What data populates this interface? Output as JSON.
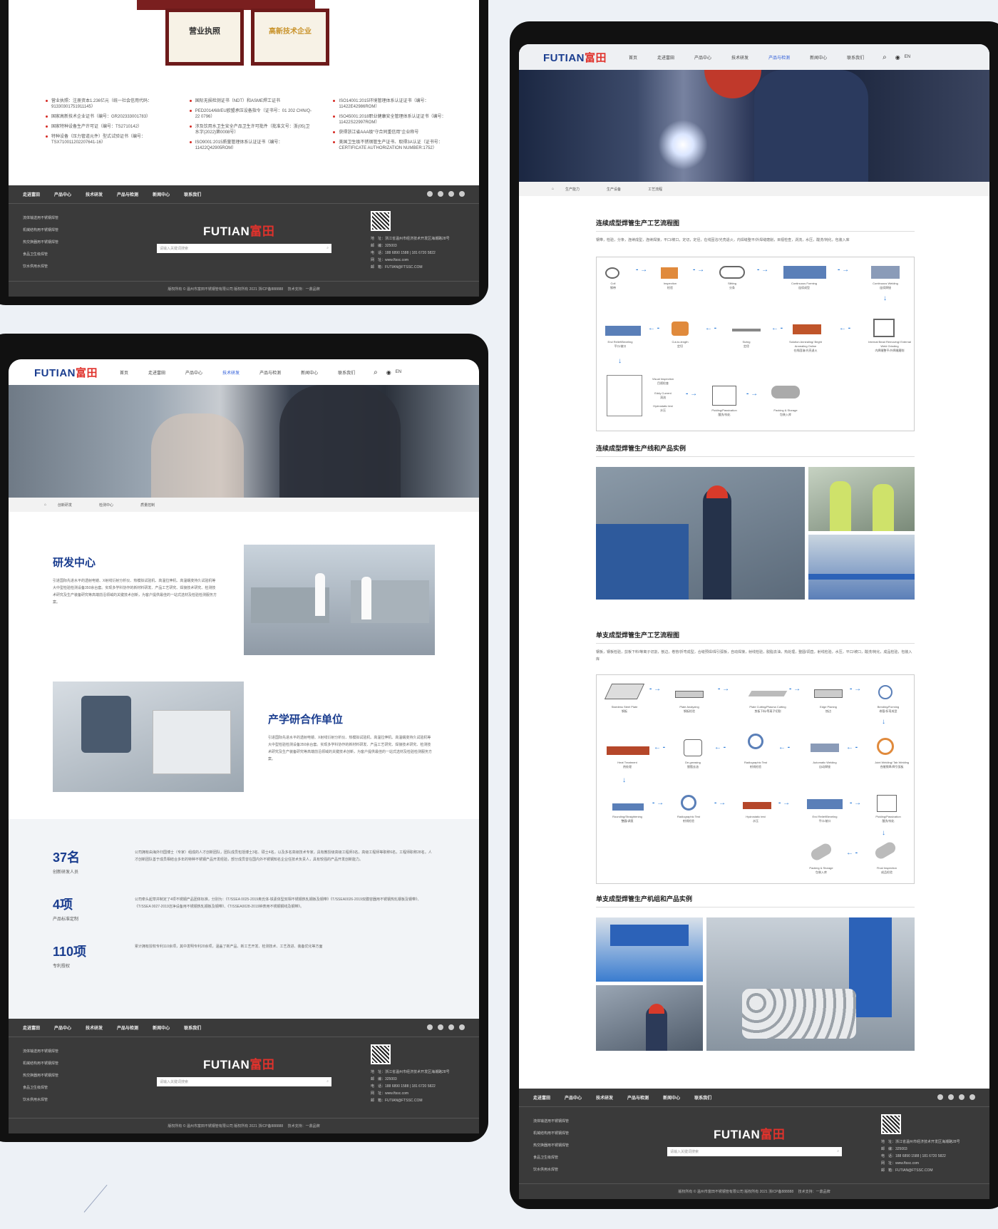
{
  "colors": {
    "brand_blue": "#1a3d8f",
    "brand_red": "#e0322c",
    "accent_blue": "#2c5bd8",
    "footer_bg": "#3a3a3a",
    "page_bg": "#edf1f6"
  },
  "logo": {
    "en": "FUTIAN",
    "cn": "富田"
  },
  "nav": [
    "首页",
    "走进富田",
    "产品中心",
    "技术研发",
    "产品与检测",
    "新闻中心",
    "联系我们"
  ],
  "lang": "EN",
  "footer": {
    "nav": [
      "走进富田",
      "产品中心",
      "技术研发",
      "产品与检测",
      "新闻中心",
      "联系我们"
    ],
    "links": [
      "流体输送用不锈钢焊管",
      "机械结构用不锈钢焊管",
      "热交换器用不锈钢焊管",
      "食品卫生级焊管",
      "饮水供用水焊管"
    ],
    "search_placeholder": "请输入关键词搜索",
    "contact": [
      "地　址：浙江省温州市经济技术开发区海潮路28号",
      "邮　编：325003",
      "电　话：188 6890 1588 | 181 6720 5822",
      "网　址：www.ftssc.com",
      "邮　箱：FUTIAN@FTSSC.COM"
    ],
    "copyright": "版权所有 © 温州市富田不锈钢管有限公司 版权所有 2021 浙ICP备888888 　技术支持：一鼎品牌"
  },
  "left_top": {
    "certificates": [
      "营业执照",
      "高新技术企业"
    ],
    "cert_cols": [
      [
        "营业执照：注册资本1.236亿元（统一社会信用代码：91330301751911145）",
        "国家高新技术企业证书（编号：GR202333001783）",
        "国家特种设备生产许可证（编号：TS2710142）",
        "特种设备（压力管道元件）型式试验证书（编号：TSX710011202207641-16）"
      ],
      [
        "国际无损检测证书（NDT）和ASME焊工证书",
        "PED2014/68/EU欧盟承压设备指令（证书号：01 202 CHN/Q-22 0796）",
        "涉及饮用水卫生安全产品卫生许可批件（批准文号：浙(05)卫水字(2022)第0008号）",
        "ISO9001:2015质量管理体系认证证书（编号：11422Q42905ROM）"
      ],
      [
        "ISO14001:2015环境管理体系认证证书（编号：11422E42986ROM）",
        "ISO45001:2018职业健康安全管理体系认证证书（编号：11422S22997ROM）",
        "获得浙江省AAA级“守合同重信用”企业称号",
        "美国卫生级不锈钢管生产证书、取得3A认证（证书号：CERTIFICATE AUTHORIZATION NUMBER:1752）"
      ]
    ]
  },
  "left_bottom": {
    "breadcrumb": [
      "创新研发",
      "检测中心",
      "质量控制"
    ],
    "rd_title": "研发中心",
    "rd_desc": "引进国际先进水平的透射电镜、X射线衍射分析仪、热模拟试验机、高温拉伸机、高温蠕变持久试验机等大中型检验检测设备350余台套。实现多学科协作的新材料研发、产品工艺研究、焊接技术研究、检测技术研究及生产装备研究等高端前沿领域的关键技术创新，为客户提供最佳的一站式选材及检验检测服务方案。",
    "coop_title": "产学研合作单位",
    "coop_desc": "引进国际先进水平的透射电镜、X射线衍射分析仪、热模拟试验机、高温拉伸机、高温蠕变持久试验机等大中型检验检测设备350余台套。实现多学科协作的新材料研发、产品工艺研究、焊接技术研究、检测技术研究及生产装备研究等高端前沿领域的关键技术创新，为客户提供最佳的一站式选材及检验检测服务方案。",
    "stats": [
      {
        "num": "37名",
        "label": "创新研发人员",
        "desc": "公司拥有由海外归国博士（专家）组成的人才创新团队，团队成员包括博士3名、硕士4名，以及多名高级技术专家，具有教授级高级工程师3名，高级工程师等职称6名，工程师职称28名。人才创新团队善于成员相结合多年的特种不锈钢产品开发经验，部分成员曾在国内外不锈钢知名企业任技术负责人，具有较强的产品开发创新能力。"
      },
      {
        "num": "4项",
        "label": "产品标准定制",
        "desc": "公司牵头起草并制定了4项不锈钢产品团体标准，分别为：《T/SSEA 0025-2019奥氏体-铁素体型双相不锈钢热轧钢板及钢带》《T/SSEA0026-2019双膜容器用不锈钢热轧钢板及钢带》、《T/SSEA 0027-2019洁净设备用不锈钢热轧钢板及钢带》、《T/SSEA0028-2019钟表用不锈钢钢线及钢带》。"
      },
      {
        "num": "110项",
        "label": "专利授权",
        "desc": "累计拥有授权专利110余项，其中发明专利20余项，涵盖了新产品、新工艺开发、检测技术、工艺改进、装备优化等方面"
      }
    ]
  },
  "right": {
    "breadcrumb": [
      "生产能力",
      "生产设备",
      "工艺流程"
    ],
    "s1_title": "连续成型焊管生产工艺流程图",
    "s1_desc": "钢带，检验，分条，连续成型，连续焊接，平口/坡口，定切，定径，在线固溶/光亮退火，内焊缝整平/外焊缝磨削，目视检查，涡流，水压，酸洗/钝化，包装入库",
    "flow1": [
      {
        "en": "Coil",
        "cn": "钢带"
      },
      {
        "en": "Inspection",
        "cn": "检验"
      },
      {
        "en": "Slitting",
        "cn": "分条"
      },
      {
        "en": "Continuous Forming",
        "cn": "连续成型"
      },
      {
        "en": "Continuous Welding",
        "cn": "连续焊接"
      },
      {
        "en": "End Relief/Beveling",
        "cn": "平口/坡口"
      },
      {
        "en": "Cut-to-length",
        "cn": "定切"
      },
      {
        "en": "Sizing",
        "cn": "定径"
      },
      {
        "en": "Solution Annealing/ Bright Annealing Online",
        "cn": "在线固溶/光亮退火"
      },
      {
        "en": "Internal Bead Removing/ External Weld Grinding",
        "cn": "内焊缝整平/外焊缝磨削"
      },
      {
        "en": "Visual Inspection",
        "cn": "目视检查"
      },
      {
        "en": "Eddy Current",
        "cn": "涡流"
      },
      {
        "en": "Hydrostatic test",
        "cn": "水压"
      },
      {
        "en": "Pickling/Passivation",
        "cn": "酸洗/钝化"
      },
      {
        "en": "Packing & Storage",
        "cn": "包装入库"
      }
    ],
    "s2_title": "连续成型焊管生产线和产品实例",
    "s3_title": "单支成型焊管生产工艺流程图",
    "s3_desc": "钢板，钢板检验，剪板下料/等离子切割，刨边，卷管/折弯成型，合缝预焊/焊引弧板，自动焊接，射线检验，脱脂去油，热处理，整圆/调直，射线检验，水压，平口/坡口，酸洗/钝化，成品检验，包装入库",
    "flow2": [
      {
        "en": "Stainless Steel Plate",
        "cn": "钢板"
      },
      {
        "en": "Plate Analyzing",
        "cn": "钢板检验"
      },
      {
        "en": "Plate Cutting/Plasma Cutting",
        "cn": "剪板下料/等离子切割"
      },
      {
        "en": "Edge Planing",
        "cn": "刨边"
      },
      {
        "en": "Bending/Forming",
        "cn": "卷管/折弯成型"
      },
      {
        "en": "Heat Treatment",
        "cn": "热处理"
      },
      {
        "en": "De-greasing",
        "cn": "脱脂去油"
      },
      {
        "en": "Radiographic Test",
        "cn": "射线检验"
      },
      {
        "en": "Automatic Welding",
        "cn": "自动焊接"
      },
      {
        "en": "Joint Welding/ Tab Welding",
        "cn": "合缝预焊/焊引弧板"
      },
      {
        "en": "Rounding/Straightening",
        "cn": "整圆/调直"
      },
      {
        "en": "Radiographic Test",
        "cn": "射线检验"
      },
      {
        "en": "Hydrostatic test",
        "cn": "水压"
      },
      {
        "en": "End Relief/Beveling",
        "cn": "平口/坡口"
      },
      {
        "en": "Pickling/Passivation",
        "cn": "酸洗/钝化"
      },
      {
        "en": "Packing & Storage",
        "cn": "包装入库"
      },
      {
        "en": "Final Inspection",
        "cn": "成品检验"
      }
    ],
    "s4_title": "单支成型焊管生产机组和产品实例"
  }
}
